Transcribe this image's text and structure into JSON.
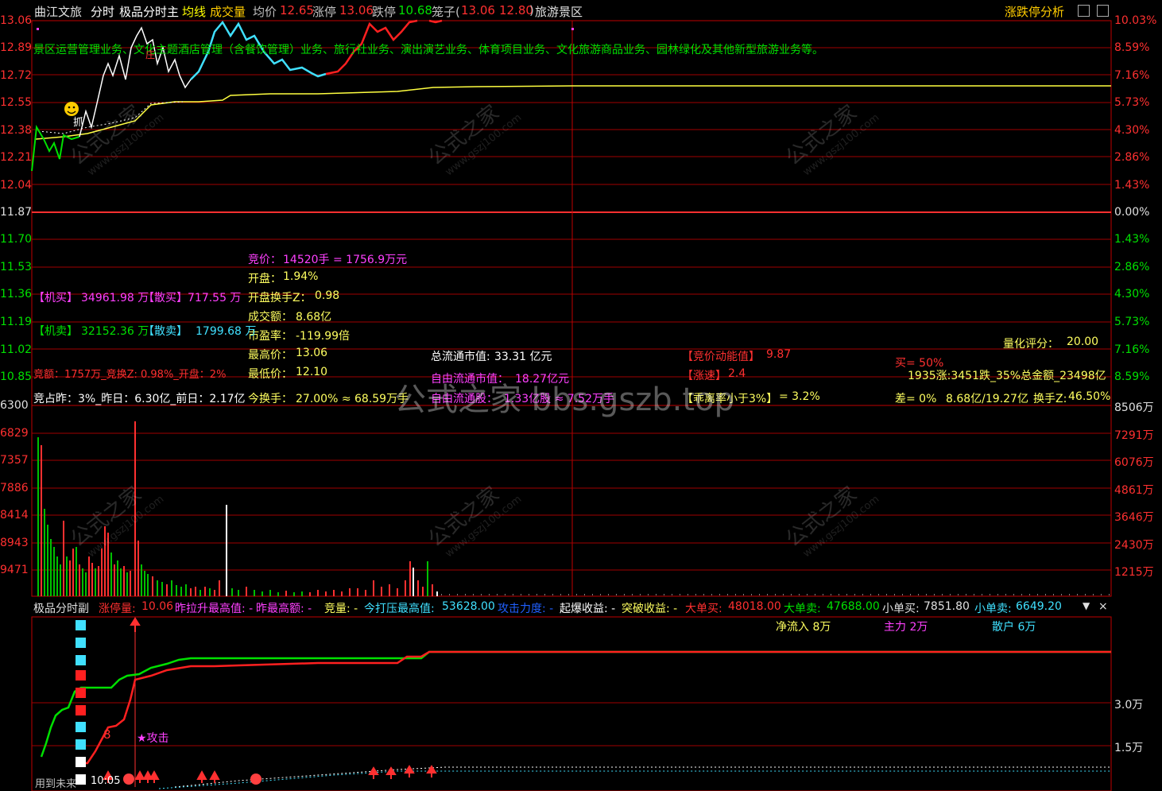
{
  "title_bar": {
    "stock_name": "曲江文旅",
    "tabs": [
      "分时",
      "极品分时主"
    ],
    "avg_line": "均线",
    "volume": "成交量",
    "avg_price_label": "均价",
    "avg_price": "12.65",
    "limit_up_label": "涨停",
    "limit_up": "13.06",
    "limit_down_label": "跌停",
    "limit_down": "10.68",
    "cage_label": "笼子(",
    "cage_high": "13.06",
    "cage_low": "12.80",
    "cage_close": ")",
    "sector": "旅游景区",
    "right_button": "涨跌停分析"
  },
  "price_axis": {
    "left": [
      "13.06",
      "12.89",
      "12.72",
      "12.55",
      "12.38",
      "12.21",
      "12.04",
      "11.87",
      "11.70",
      "11.53",
      "11.36",
      "11.19",
      "11.02",
      "10.85"
    ],
    "right": [
      "10.03%",
      "8.59%",
      "7.16%",
      "5.73%",
      "4.30%",
      "2.86%",
      "1.43%",
      "0.00%",
      "1.43%",
      "2.86%",
      "4.30%",
      "5.73%",
      "7.16%",
      "8.59%"
    ]
  },
  "volume_axis": {
    "left": [
      "6300",
      "6829",
      "7357",
      "7886",
      "8414",
      "8943",
      "9471"
    ],
    "right": [
      "8506万",
      "7291万",
      "6076万",
      "4861万",
      "3646万",
      "2430万",
      "1215万"
    ]
  },
  "business_text": "景区运营管理业务、文化主题酒店管理（含餐饮管理）业务、旅行社业务、演出演艺业务、体育项目业务、文化旅游商品业务、园林绿化及其他新型旅游业务等。",
  "markers": {
    "zhua": "抓",
    "zhuang": "庄"
  },
  "stats": {
    "bid_label": "竞价：",
    "bid_value": "14520手 = 1756.9万元",
    "open_label": "开盘：",
    "open_value": "1.94%",
    "open_turnover_label": "开盘换手Z：",
    "open_turnover_value": "0.98",
    "amount_label": "成交额：",
    "amount_value": "8.68亿",
    "pe_label": "市盈率：",
    "pe_value": "-119.99倍",
    "high_label": "最高价：",
    "high_value": "13.06",
    "low_label": "最低价：",
    "low_value": "12.10",
    "turnover_label": "今换手：",
    "turnover_value": "27.00% ≈ 68.59万手",
    "inst_buy_label": "【机买】",
    "inst_buy_value": "34961.98 万",
    "retail_buy_label": "【散买】",
    "retail_buy_value": "717.55 万",
    "inst_sell_label": "【机卖】",
    "inst_sell_value": "32152.36 万",
    "retail_sell_label": "【散卖】",
    "retail_sell_value": "1799.68 万",
    "bid_amount_line": "竞额：1757万_竞换Z: 0.98%_开盘：2%",
    "bid_ratio_line": "竞占昨：3%_昨日：6.30亿_前日：2.17亿",
    "total_mv_label": "总流通市值:",
    "total_mv_value": "33.31 亿元",
    "free_mv_label": "自由流通市值：",
    "free_mv_value": "18.27亿元",
    "free_shares_label": "自由流通股：",
    "free_shares_value": "1.33亿股 ≈ 7.52万手",
    "bid_energy_label": "【竞价动能值】",
    "bid_energy_value": "9.87",
    "speed_label": "【涨速】",
    "speed_value": "2.4",
    "deviation_label": "【乖离率小于3%】",
    "deviation_value": "= 3.2%",
    "quant_label": "量化评分：",
    "quant_value": "20.00",
    "buy_ratio": "买= 50%",
    "market_line": "1935涨:3451跌_35%总金额_23498亿",
    "diff_label": "差= 0%",
    "diff_value": "8.68亿/19.27亿",
    "turnover_z_label": "换手Z:",
    "turnover_z_value": "46.50%"
  },
  "sub_panel": {
    "title": "极品分时副",
    "limit_up_vol_label": "涨停量:",
    "limit_up_vol_value": "10.06",
    "prev_high_pull_label": "昨拉升最高值: -",
    "prev_high_amt_label": "昨最高额: -",
    "bid_vol_label": "竞量: -",
    "suppress_label": "今打压最高值:",
    "suppress_value": "53628.00",
    "attack_force_label": "攻击力度: -",
    "burst_label": "起爆收益: -",
    "break_label": "突破收益: -",
    "big_buy_label": "大单买:",
    "big_buy_value": "48018.00",
    "big_sell_label": "大单卖:",
    "big_sell_value": "47688.00",
    "small_buy_label": "小单买:",
    "small_buy_value": "7851.80",
    "small_sell_label": "小单卖:",
    "small_sell_value": "6649.20",
    "net_inflow": "净流入 8万",
    "main_force": "主力 2万",
    "retail": "散户 6万",
    "axis": [
      "3.0万",
      "1.5万"
    ],
    "attack_label": "★攻击",
    "marker_8": "8",
    "time_label": "10:05",
    "bottom_label": "用到未来"
  },
  "watermark": {
    "main": "公式之家 bbs.gszb.top",
    "small_cn": "公式之家",
    "small_url": "www.gszj100.com"
  },
  "chart_data": {
    "type": "line",
    "title": "曲江文旅 分时",
    "ylim": [
      10.68,
      13.06
    ],
    "prev_close": 11.87,
    "price_path_note": "intraday price rises from ~12.20 at open to limit-up 13.06",
    "price": [
      12.21,
      12.4,
      12.3,
      12.38,
      12.35,
      12.45,
      12.6,
      12.98,
      12.8,
      12.9,
      12.78,
      12.66,
      12.85,
      13.06,
      12.98,
      12.9,
      12.82,
      12.79,
      12.78,
      12.79,
      12.86,
      12.98,
      13.06,
      13.06
    ],
    "avg": [
      12.3,
      12.33,
      12.35,
      12.38,
      12.48,
      12.54,
      12.56,
      12.58,
      12.6,
      12.62,
      12.63,
      12.64,
      12.64,
      12.65,
      12.65,
      12.65
    ],
    "volume_max": 8506
  }
}
